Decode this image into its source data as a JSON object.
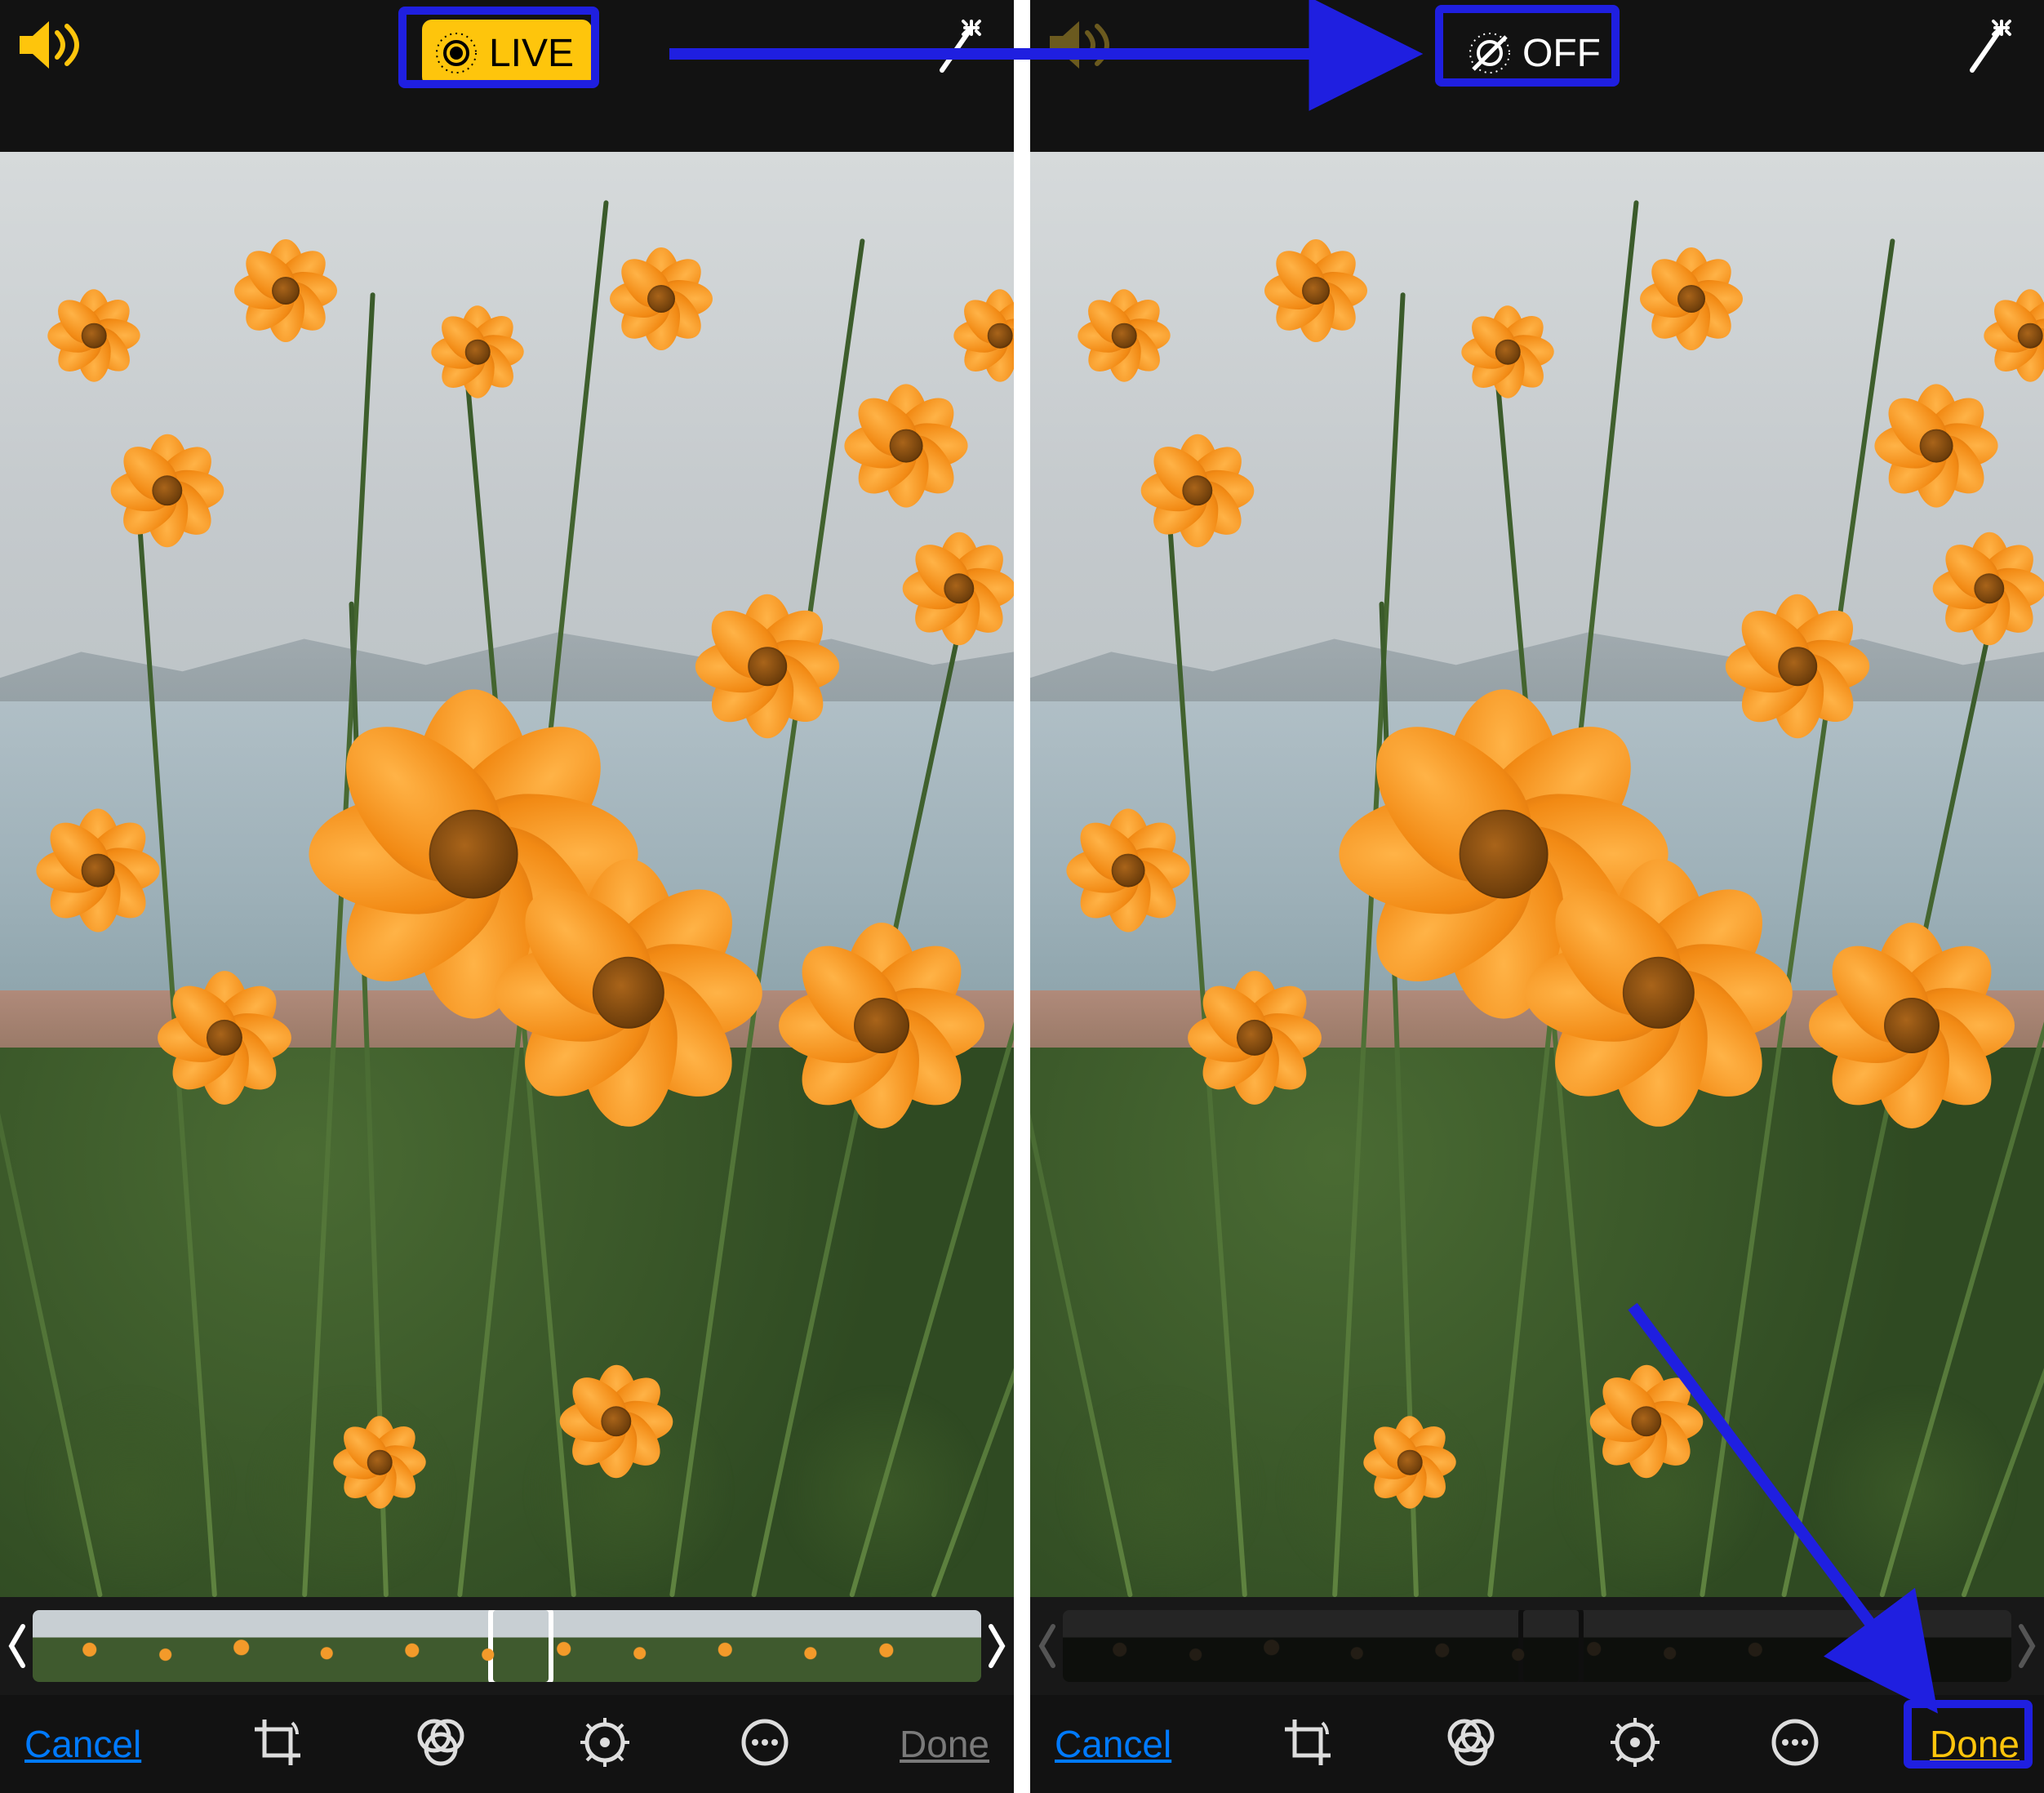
{
  "colors": {
    "accent_yellow": "#fec50c",
    "accent_blue": "#007aff",
    "annotation_blue": "#1f1fe0"
  },
  "left": {
    "sound_active": true,
    "live_toggle": {
      "label": "LIVE",
      "active": true,
      "annotated": true
    },
    "filmstrip": {
      "dimmed": false,
      "marker_percent": 48
    },
    "toolbar": {
      "cancel": "Cancel",
      "done": "Done",
      "done_enabled": false
    }
  },
  "right": {
    "sound_active": false,
    "live_toggle": {
      "label": "OFF",
      "active": false,
      "annotated": true
    },
    "filmstrip": {
      "dimmed": true,
      "marker_percent": 48
    },
    "toolbar": {
      "cancel": "Cancel",
      "done": "Done",
      "done_enabled": true,
      "done_annotated": true
    }
  }
}
